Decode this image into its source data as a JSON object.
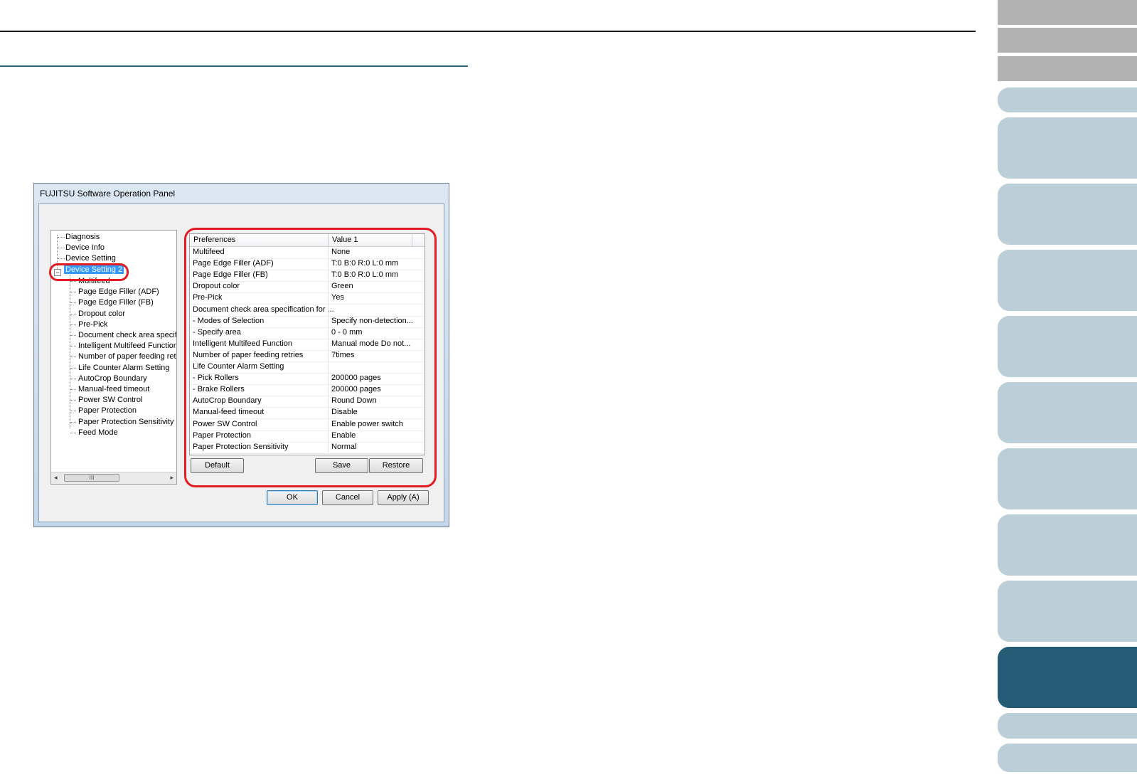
{
  "dialog": {
    "title": "FUJITSU Software Operation Panel",
    "tree": {
      "items": [
        "Diagnosis",
        "Device Info",
        "Device Setting",
        "Device Setting 2"
      ],
      "children": [
        "Multifeed",
        "Page Edge Filler (ADF)",
        "Page Edge Filler (FB)",
        "Dropout color",
        "Pre-Pick",
        "Document check area specific",
        "Intelligent Multifeed Function",
        "Number of paper feeding retries",
        "Life Counter Alarm Setting",
        "AutoCrop Boundary",
        "Manual-feed timeout",
        "Power SW Control",
        "Paper Protection",
        "Paper Protection Sensitivity",
        "Feed Mode"
      ],
      "expander": "−",
      "scroll_thumb": "III",
      "scroll_left": "◂",
      "scroll_right": "▸"
    },
    "table": {
      "headers": [
        "Preferences",
        "Value 1"
      ],
      "rows": [
        [
          "Multifeed",
          "None"
        ],
        [
          "Page Edge Filler (ADF)",
          "T:0  B:0  R:0  L:0 mm"
        ],
        [
          "Page Edge Filler (FB)",
          "T:0  B:0  R:0  L:0 mm"
        ],
        [
          "Dropout color",
          "Green"
        ],
        [
          "Pre-Pick",
          "Yes"
        ],
        [
          "Document check area specification for ...",
          ""
        ],
        [
          " - Modes of Selection",
          "Specify non-detection..."
        ],
        [
          " - Specify area",
          "0 - 0 mm"
        ],
        [
          "Intelligent Multifeed Function",
          "Manual mode  Do not..."
        ],
        [
          "Number of paper feeding retries",
          "7times"
        ],
        [
          "Life Counter Alarm Setting",
          ""
        ],
        [
          " - Pick Rollers",
          "200000 pages"
        ],
        [
          " - Brake Rollers",
          "200000 pages"
        ],
        [
          "AutoCrop Boundary",
          "Round Down"
        ],
        [
          "Manual-feed timeout",
          "Disable"
        ],
        [
          "Power SW Control",
          "Enable power switch"
        ],
        [
          "Paper Protection",
          "Enable"
        ],
        [
          "Paper Protection Sensitivity",
          "Normal"
        ]
      ]
    },
    "buttons": {
      "default": "Default",
      "save": "Save",
      "restore": "Restore",
      "ok": "OK",
      "cancel": "Cancel",
      "apply": "Apply (A)"
    }
  },
  "colors": {
    "highlight": "#e31b23",
    "nav_active": "#265b76",
    "nav_light": "#bccfd9",
    "nav_gray": "#b2b2b2",
    "rule": "#2c5f7a"
  }
}
